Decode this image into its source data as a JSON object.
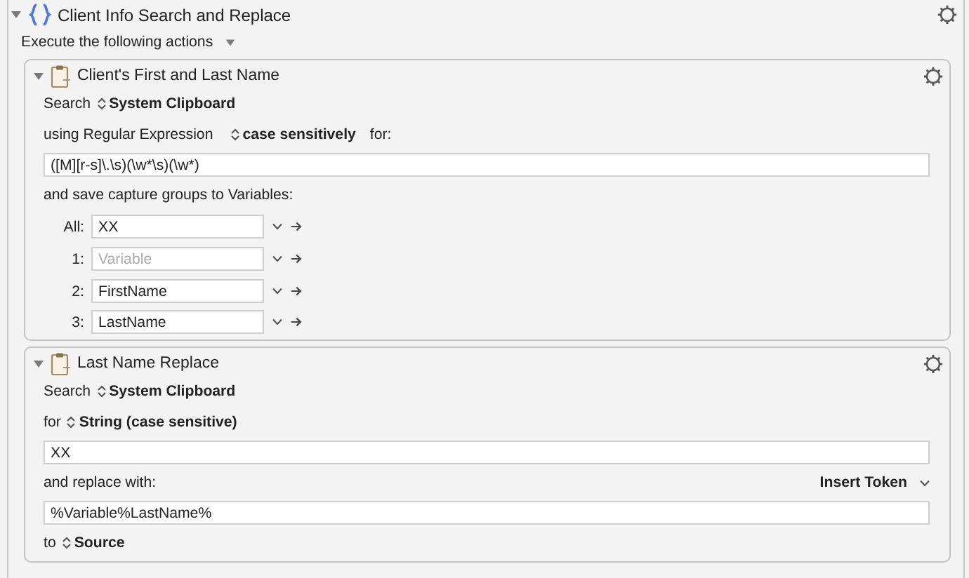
{
  "group": {
    "title": "Client Info Search and Replace",
    "expanded": true,
    "subtitle": "Execute the following actions"
  },
  "actions": [
    {
      "title": "Client's First and Last Name",
      "expanded": true,
      "rows": [
        {
          "kind": "popup",
          "label": "Search",
          "value": "System Clipboard"
        },
        {
          "kind": "popup",
          "label": "using Regular Expression",
          "value": "case sensitively",
          "suffix": "for:"
        },
        {
          "kind": "field",
          "value": "([M][r-s]\\.\\s)(\\w*\\s)(\\w*)"
        },
        {
          "kind": "text",
          "text": "and save capture groups to Variables:"
        },
        {
          "kind": "capture",
          "label": "All:",
          "value": "XX"
        },
        {
          "kind": "capture",
          "label": "1:",
          "placeholder": "Variable"
        },
        {
          "kind": "capture",
          "label": "2:",
          "value": "FirstName"
        },
        {
          "kind": "capture",
          "label": "3:",
          "value": "LastName"
        }
      ]
    },
    {
      "title": "Last Name Replace",
      "expanded": true,
      "rows": [
        {
          "kind": "popup",
          "label": "Search",
          "value": "System Clipboard"
        },
        {
          "kind": "popup",
          "label": "for",
          "value": "String (case sensitive)"
        },
        {
          "kind": "field",
          "value": "XX"
        },
        {
          "kind": "text",
          "text": "and replace with:",
          "menu": "Insert Token"
        },
        {
          "kind": "field",
          "value": "%Variable%LastName%"
        },
        {
          "kind": "popup",
          "label": "to",
          "value": "Source"
        }
      ]
    }
  ]
}
